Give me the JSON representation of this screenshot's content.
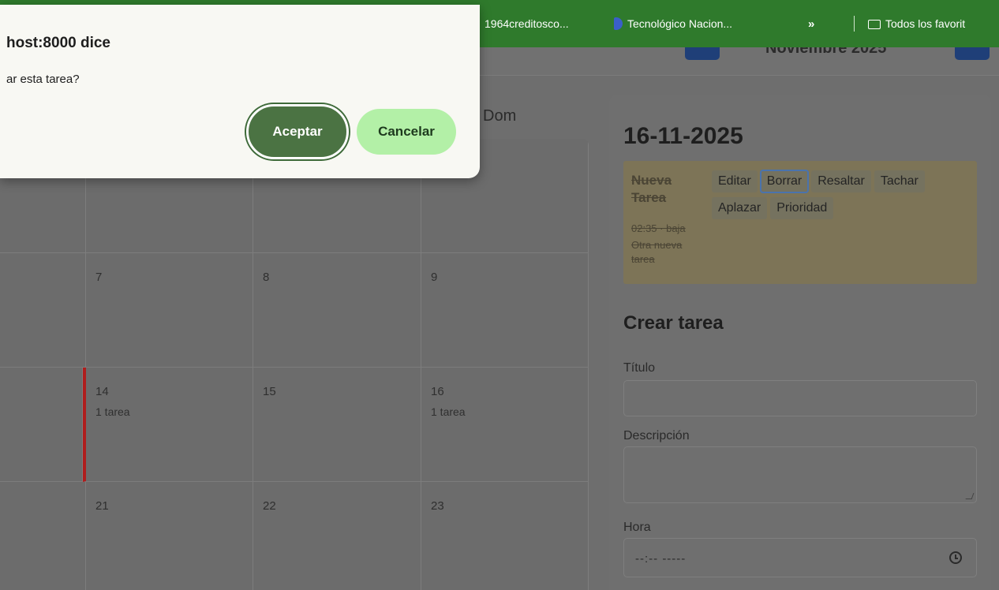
{
  "bookmarks": {
    "items": [
      {
        "label": "1964creditosco..."
      },
      {
        "label": "Tecnológico Nacion..."
      },
      {
        "label": "»"
      },
      {
        "label": "Todos los favorit"
      }
    ]
  },
  "header": {
    "month_title": "Noviembre 2025"
  },
  "calendar": {
    "weekday_visible": "Dom",
    "cells": [
      {
        "num": "7",
        "count": ""
      },
      {
        "num": "8",
        "count": ""
      },
      {
        "num": "9",
        "count": ""
      },
      {
        "num": "14",
        "count": "1 tarea"
      },
      {
        "num": "15",
        "count": ""
      },
      {
        "num": "16",
        "count": "1 tarea"
      },
      {
        "num": "21",
        "count": ""
      },
      {
        "num": "22",
        "count": ""
      },
      {
        "num": "23",
        "count": ""
      }
    ]
  },
  "panel": {
    "date_title": "16-11-2025",
    "task": {
      "title": "Nueva Tarea",
      "meta": "02:35 · baja",
      "desc": "Otra nueva tarea",
      "actions": [
        "Editar",
        "Borrar",
        "Resaltar",
        "Tachar",
        "Aplazar",
        "Prioridad"
      ]
    },
    "form": {
      "section_title": "Crear tarea",
      "titulo_label": "Título",
      "titulo_value": "",
      "descripcion_label": "Descripción",
      "descripcion_value": "",
      "hora_label": "Hora",
      "hora_value": "--:-- -----"
    }
  },
  "dialog": {
    "title": "host:8000 dice",
    "message": "ar esta tarea?",
    "accept_label": "Aceptar",
    "cancel_label": "Cancelar"
  },
  "colors": {
    "bookmarks_bg": "#2f7a2c",
    "accept_bg": "#4b7343",
    "cancel_bg": "#b3f0a7",
    "task_card_bg": "#7d7457",
    "marker_red": "#b01d1d"
  }
}
